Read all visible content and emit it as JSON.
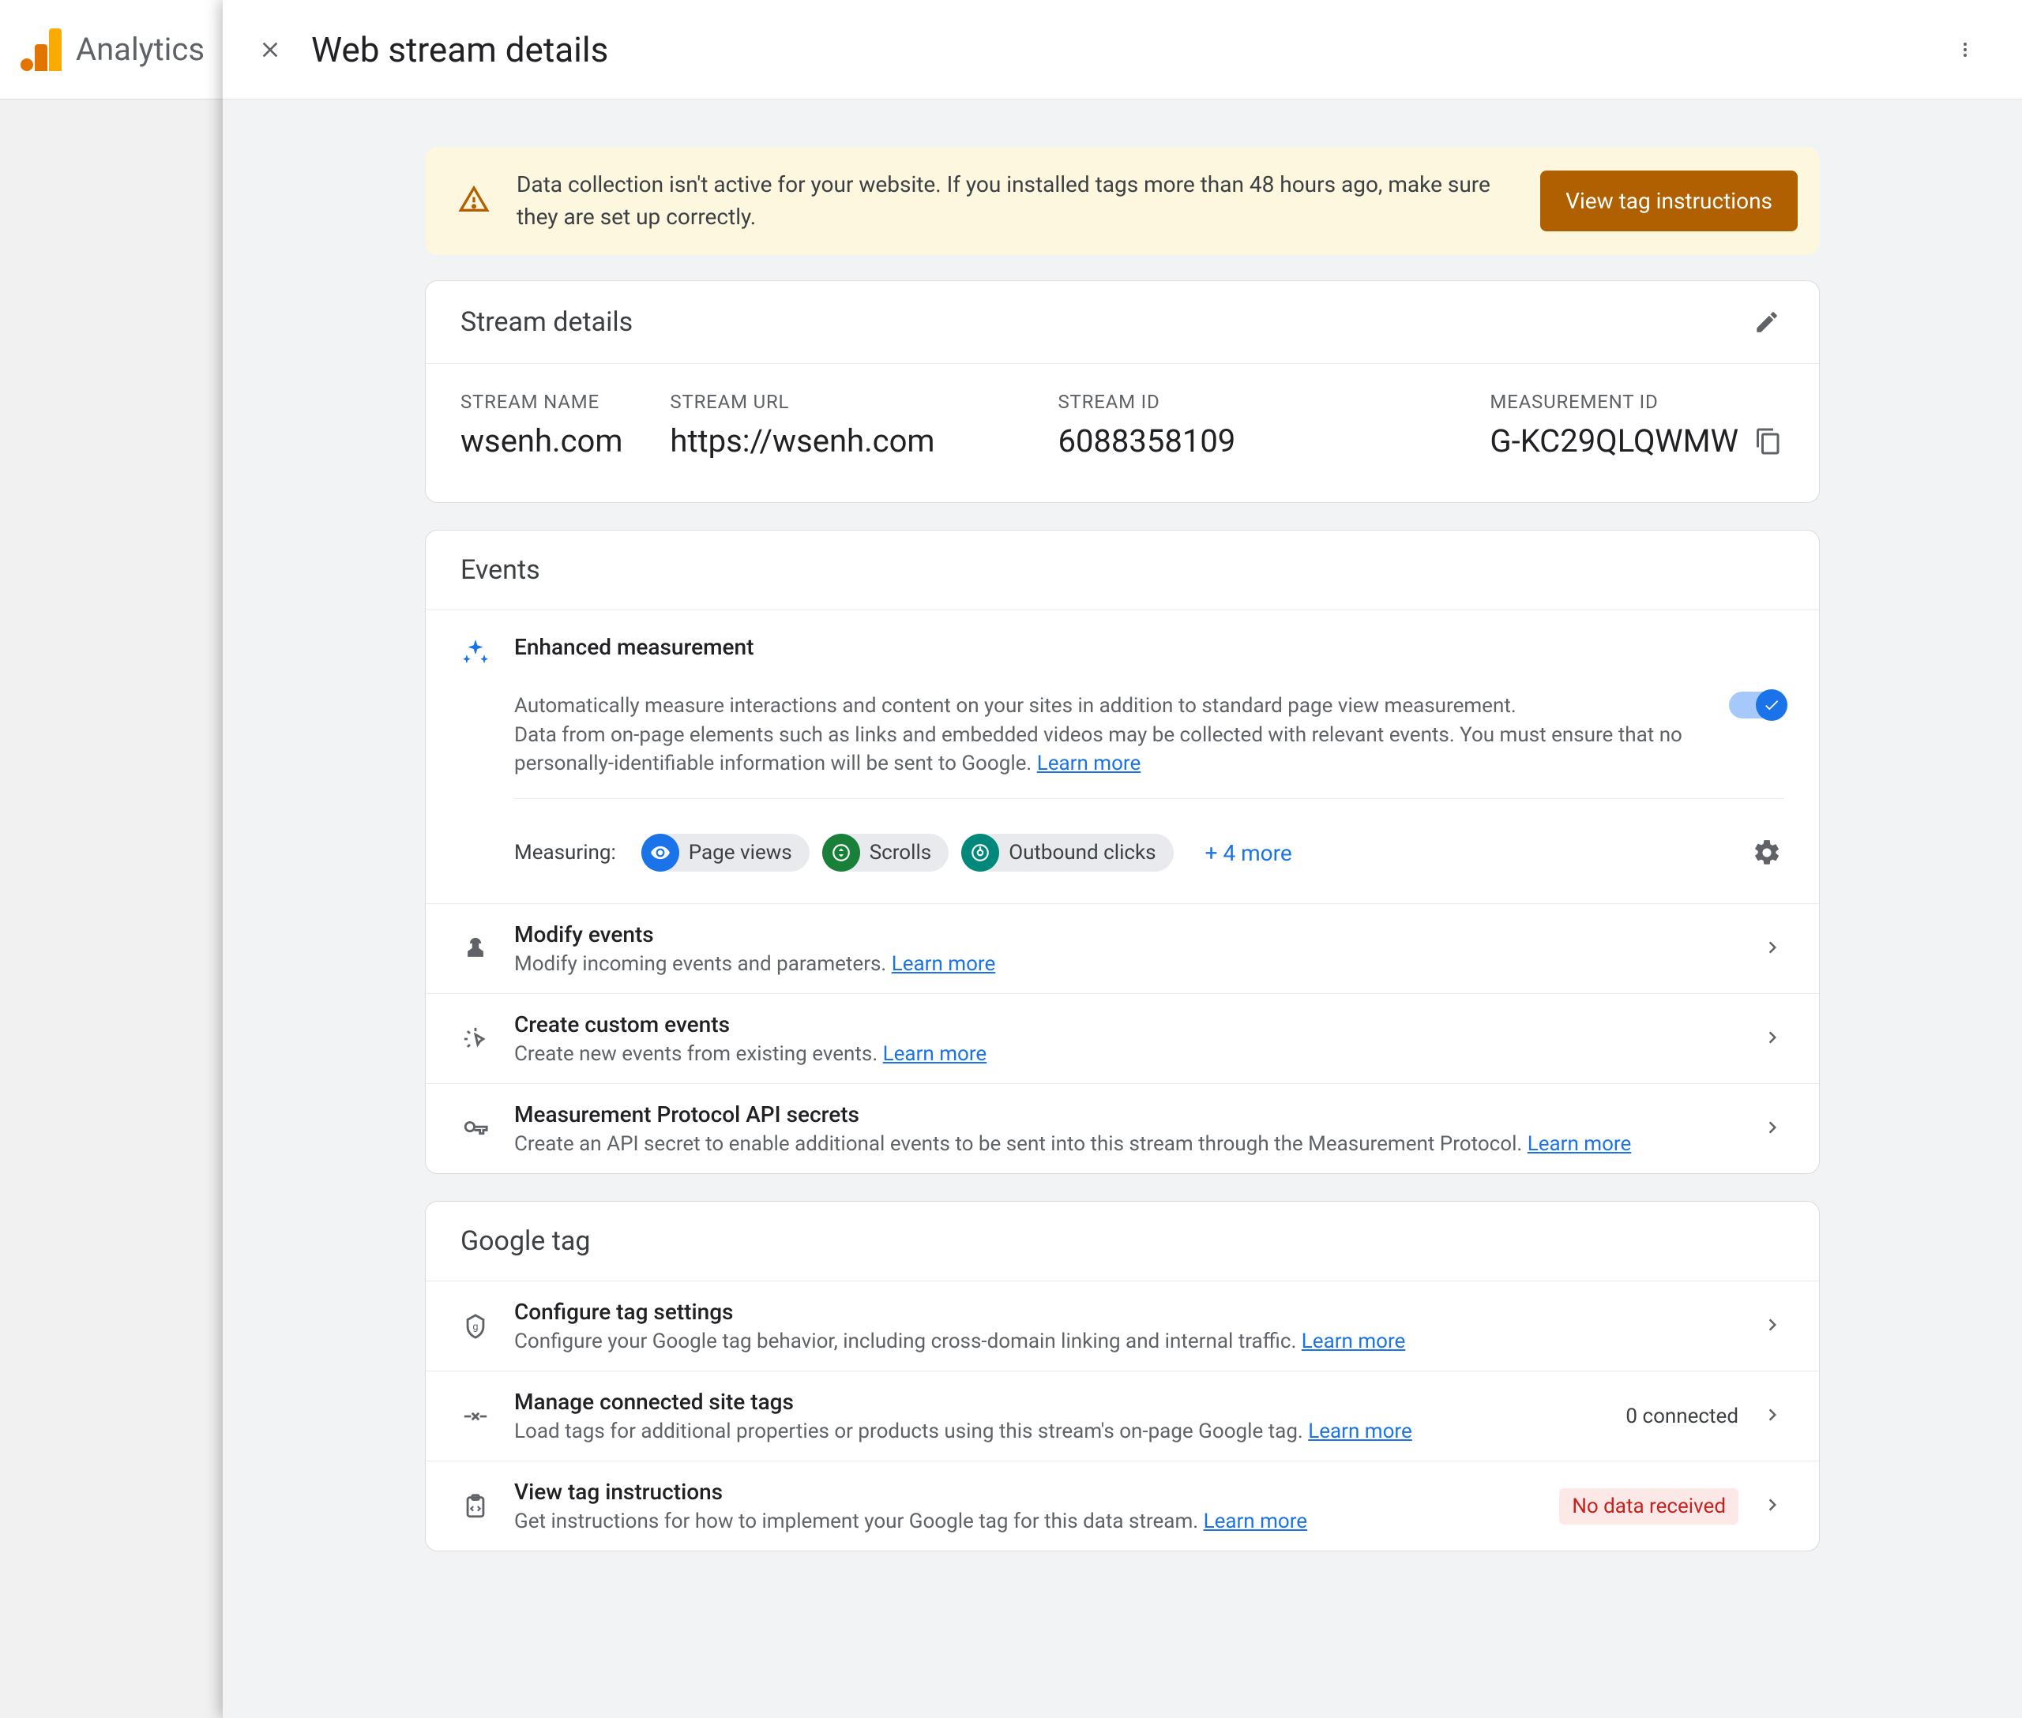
{
  "brand": "Analytics",
  "panel": {
    "title": "Web stream details"
  },
  "warning": {
    "text": "Data collection isn't active for your website. If you installed tags more than 48 hours ago, make sure they are set up correctly.",
    "button": "View tag instructions"
  },
  "stream": {
    "header": "Stream details",
    "name_label": "STREAM NAME",
    "name_value": "wsenh.com",
    "url_label": "STREAM URL",
    "url_value": "https://wsenh.com",
    "id_label": "STREAM ID",
    "id_value": "6088358109",
    "measurement_label": "MEASUREMENT ID",
    "measurement_value": "G-KC29QLQWMW"
  },
  "events": {
    "header": "Events",
    "enhanced": {
      "title": "Enhanced measurement",
      "desc1": "Automatically measure interactions and content on your sites in addition to standard page view measurement.",
      "desc2": "Data from on-page elements such as links and embedded videos may be collected with relevant events. You must ensure that no personally-identifiable information will be sent to Google. ",
      "learn": "Learn more",
      "toggle_on": true,
      "measuring_label": "Measuring:",
      "chips": [
        {
          "label": "Page views",
          "color": "blue"
        },
        {
          "label": "Scrolls",
          "color": "green"
        },
        {
          "label": "Outbound clicks",
          "color": "teal"
        }
      ],
      "more": "+ 4 more"
    },
    "items": [
      {
        "title": "Modify events",
        "desc": "Modify incoming events and parameters. ",
        "learn": "Learn more"
      },
      {
        "title": "Create custom events",
        "desc": "Create new events from existing events. ",
        "learn": "Learn more"
      },
      {
        "title": "Measurement Protocol API secrets",
        "desc": "Create an API secret to enable additional events to be sent into this stream through the Measurement Protocol. ",
        "learn": "Learn more"
      }
    ]
  },
  "googleTag": {
    "header": "Google tag",
    "items": [
      {
        "title": "Configure tag settings",
        "desc": "Configure your Google tag behavior, including cross-domain linking and internal traffic. ",
        "learn": "Learn more"
      },
      {
        "title": "Manage connected site tags",
        "desc": "Load tags for additional properties or products using this stream's on-page Google tag. ",
        "learn": "Learn more",
        "meta": "0 connected"
      },
      {
        "title": "View tag instructions",
        "desc": "Get instructions for how to implement your Google tag for this data stream. ",
        "learn": "Learn more",
        "badge": "No data received"
      }
    ]
  }
}
